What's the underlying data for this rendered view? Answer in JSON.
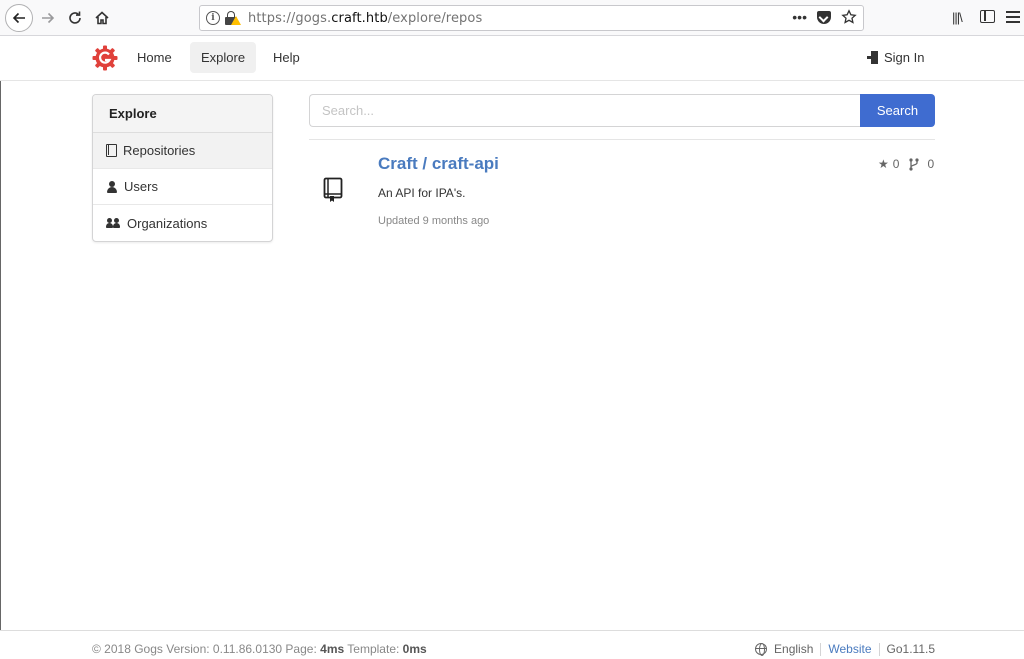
{
  "browser": {
    "url_prefix": "https://gogs.",
    "url_domain": "craft.htb",
    "url_path": "/explore/repos",
    "more_label": "•••"
  },
  "header": {
    "nav": [
      {
        "label": "Home"
      },
      {
        "label": "Explore"
      },
      {
        "label": "Help"
      }
    ],
    "sign_in": "Sign In"
  },
  "sidebar": {
    "title": "Explore",
    "items": [
      {
        "label": "Repositories"
      },
      {
        "label": "Users"
      },
      {
        "label": "Organizations"
      }
    ]
  },
  "search": {
    "placeholder": "Search...",
    "button": "Search"
  },
  "repos": [
    {
      "title": "Craft / craft-api",
      "description": "An API for IPA's.",
      "updated": "Updated 9 months ago",
      "stars": "0",
      "forks": "0"
    }
  ],
  "footer": {
    "copyright": "© 2018 Gogs Version: 0.11.86.0130 Page:",
    "page_time": "4ms",
    "template_label": "Template:",
    "template_time": "0ms",
    "language": "English",
    "website": "Website",
    "go_version": "Go1.11.5"
  },
  "colors": {
    "accent": "#3f6cd0",
    "link": "#4a7bbf",
    "logo": "#e0413b"
  }
}
